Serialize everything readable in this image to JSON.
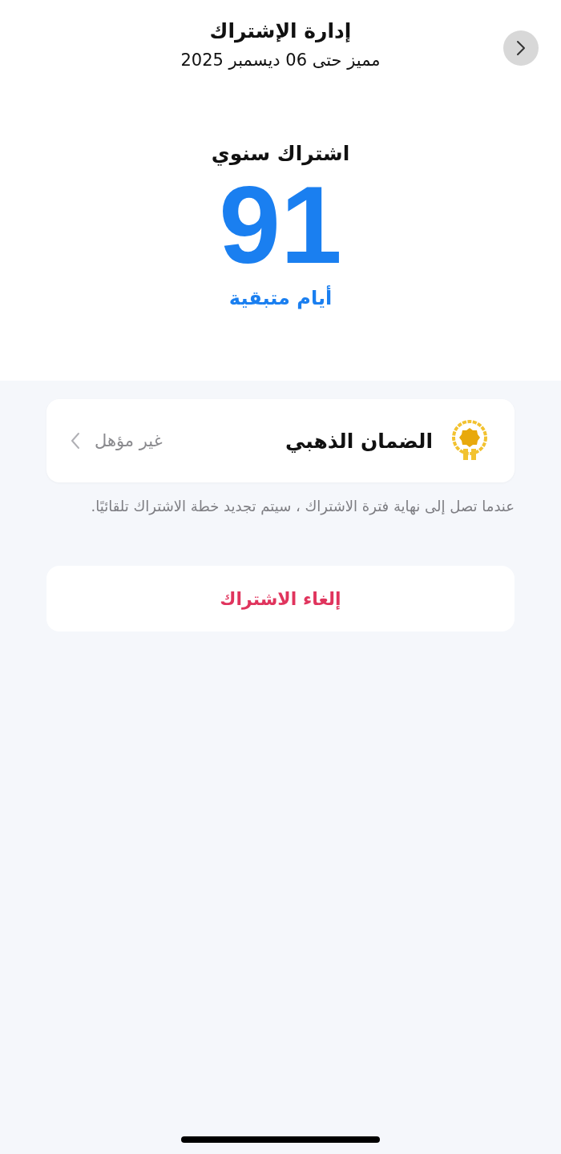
{
  "header": {
    "title": "إدارة الإشتراك",
    "subtitle": "مميز حتى 06 ديسمبر 2025"
  },
  "subscription": {
    "plan": "اشتراك سنوي",
    "days": "91",
    "days_label": "أيام متبقية"
  },
  "warranty": {
    "title": "الضمان الذهبي",
    "status": "غير مؤهل"
  },
  "note": "عندما تصل إلى نهاية فترة الاشتراك ، سيتم تجديد خطة الاشتراك تلقائيًا.",
  "cancel_button": "إلغاء الاشتراك"
}
